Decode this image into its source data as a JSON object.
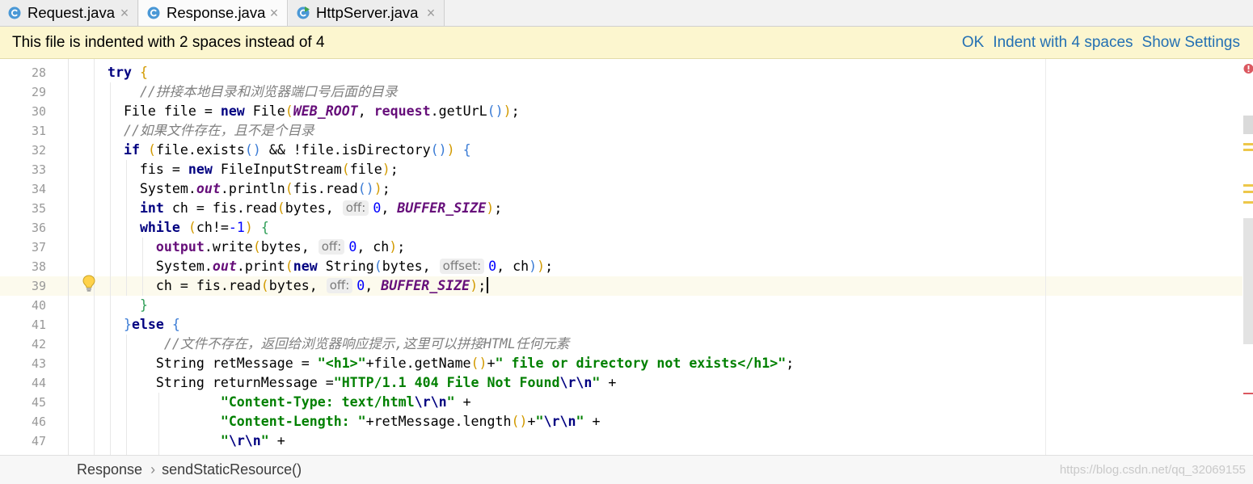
{
  "tabs": [
    {
      "label": "Request.java",
      "active": false,
      "icon": "java-class-icon"
    },
    {
      "label": "Response.java",
      "active": true,
      "icon": "java-class-icon"
    },
    {
      "label": "HttpServer.java",
      "active": false,
      "icon": "java-runnable-class-icon"
    }
  ],
  "tab_close_glyph": "×",
  "notification": {
    "message": "This file is indented with 2 spaces instead of 4",
    "actions": [
      "OK",
      "Indent with 4 spaces",
      "Show Settings"
    ]
  },
  "editor": {
    "caret_line": 39,
    "lines": [
      {
        "num": "28",
        "tokens": [
          [
            "    ",
            "txt"
          ],
          [
            "try",
            "kw"
          ],
          [
            " ",
            "txt"
          ],
          [
            "{",
            "b1"
          ]
        ]
      },
      {
        "num": "29",
        "tokens": [
          [
            "        ",
            "txt"
          ],
          [
            "//拼接本地目录和浏览器端口号后面的目录",
            "cm"
          ]
        ]
      },
      {
        "num": "30",
        "tokens": [
          [
            "      File file = ",
            "txt"
          ],
          [
            "new",
            "kw"
          ],
          [
            " File",
            "txt"
          ],
          [
            "(",
            "b1"
          ],
          [
            "WEB_ROOT",
            "st"
          ],
          [
            ", ",
            "txt"
          ],
          [
            "request",
            "fld"
          ],
          [
            ".getUrL",
            "txt"
          ],
          [
            "(",
            "b2"
          ],
          [
            ")",
            "b2"
          ],
          [
            ")",
            "b1"
          ],
          [
            ";",
            "txt"
          ]
        ]
      },
      {
        "num": "31",
        "tokens": [
          [
            "      ",
            "txt"
          ],
          [
            "//如果文件存在，且不是个目录",
            "cm"
          ]
        ]
      },
      {
        "num": "32",
        "tokens": [
          [
            "      ",
            "txt"
          ],
          [
            "if",
            "kw"
          ],
          [
            " ",
            "txt"
          ],
          [
            "(",
            "b1"
          ],
          [
            "file.exists",
            "txt"
          ],
          [
            "(",
            "b2"
          ],
          [
            ")",
            "b2"
          ],
          [
            " && !file.isDirectory",
            "txt"
          ],
          [
            "(",
            "b2"
          ],
          [
            ")",
            "b2"
          ],
          [
            ")",
            "b1"
          ],
          [
            " ",
            "txt"
          ],
          [
            "{",
            "b2"
          ]
        ]
      },
      {
        "num": "33",
        "tokens": [
          [
            "        fis = ",
            "txt"
          ],
          [
            "new",
            "kw"
          ],
          [
            " FileInputStream",
            "txt"
          ],
          [
            "(",
            "b1"
          ],
          [
            "file",
            "txt"
          ],
          [
            ")",
            "b1"
          ],
          [
            ";",
            "txt"
          ]
        ]
      },
      {
        "num": "34",
        "tokens": [
          [
            "        System.",
            "txt"
          ],
          [
            "out",
            "st"
          ],
          [
            ".println",
            "txt"
          ],
          [
            "(",
            "b1"
          ],
          [
            "fis.read",
            "txt"
          ],
          [
            "(",
            "b2"
          ],
          [
            ")",
            "b2"
          ],
          [
            ")",
            "b1"
          ],
          [
            ";",
            "txt"
          ]
        ]
      },
      {
        "num": "35",
        "tokens": [
          [
            "        ",
            "txt"
          ],
          [
            "int",
            "kw"
          ],
          [
            " ch = fis.read",
            "txt"
          ],
          [
            "(",
            "b1"
          ],
          [
            "bytes, ",
            "txt"
          ],
          [
            "off:",
            "hint"
          ],
          [
            "0",
            "num"
          ],
          [
            ", ",
            "txt"
          ],
          [
            "BUFFER_SIZE",
            "st"
          ],
          [
            ")",
            "b1"
          ],
          [
            ";",
            "txt"
          ]
        ]
      },
      {
        "num": "36",
        "tokens": [
          [
            "        ",
            "txt"
          ],
          [
            "while",
            "kw"
          ],
          [
            " ",
            "txt"
          ],
          [
            "(",
            "b1"
          ],
          [
            "ch!=",
            "txt"
          ],
          [
            "-1",
            "num"
          ],
          [
            ")",
            "b1"
          ],
          [
            " ",
            "txt"
          ],
          [
            "{",
            "b3"
          ]
        ]
      },
      {
        "num": "37",
        "tokens": [
          [
            "          ",
            "txt"
          ],
          [
            "output",
            "fld"
          ],
          [
            ".write",
            "txt"
          ],
          [
            "(",
            "b1"
          ],
          [
            "bytes, ",
            "txt"
          ],
          [
            "off:",
            "hint"
          ],
          [
            "0",
            "num"
          ],
          [
            ", ch",
            "txt"
          ],
          [
            ")",
            "b1"
          ],
          [
            ";",
            "txt"
          ]
        ]
      },
      {
        "num": "38",
        "tokens": [
          [
            "          System.",
            "txt"
          ],
          [
            "out",
            "st"
          ],
          [
            ".print",
            "txt"
          ],
          [
            "(",
            "b1"
          ],
          [
            "new",
            "kw"
          ],
          [
            " String",
            "txt"
          ],
          [
            "(",
            "b2"
          ],
          [
            "bytes, ",
            "txt"
          ],
          [
            "offset:",
            "hint"
          ],
          [
            "0",
            "num"
          ],
          [
            ", ch",
            "txt"
          ],
          [
            ")",
            "b2"
          ],
          [
            ")",
            "b1"
          ],
          [
            ";",
            "txt"
          ]
        ]
      },
      {
        "num": "39",
        "tokens": [
          [
            "          ch = fis.read",
            "txt"
          ],
          [
            "(",
            "b1"
          ],
          [
            "bytes, ",
            "txt"
          ],
          [
            "off:",
            "hint"
          ],
          [
            "0",
            "num"
          ],
          [
            ", ",
            "txt"
          ],
          [
            "BUFFER_SIZE",
            "st"
          ],
          [
            ")",
            "b1"
          ],
          [
            ";",
            "txt"
          ]
        ]
      },
      {
        "num": "40",
        "tokens": [
          [
            "        ",
            "txt"
          ],
          [
            "}",
            "b3"
          ]
        ]
      },
      {
        "num": "41",
        "tokens": [
          [
            "      ",
            "txt"
          ],
          [
            "}",
            "b2"
          ],
          [
            "else",
            "kw"
          ],
          [
            " ",
            "txt"
          ],
          [
            "{",
            "b2"
          ]
        ]
      },
      {
        "num": "42",
        "tokens": [
          [
            "           ",
            "txt"
          ],
          [
            "//文件不存在，返回给浏览器响应提示,这里可以拼接HTML任何元素",
            "cm"
          ]
        ]
      },
      {
        "num": "43",
        "tokens": [
          [
            "          String retMessage = ",
            "txt"
          ],
          [
            "\"<h1>\"",
            "str"
          ],
          [
            "+file.getName",
            "txt"
          ],
          [
            "(",
            "b1"
          ],
          [
            ")",
            "b1"
          ],
          [
            "+",
            "txt"
          ],
          [
            "\" file or directory not exists</h1>\"",
            "str"
          ],
          [
            ";",
            "txt"
          ]
        ]
      },
      {
        "num": "44",
        "tokens": [
          [
            "          String returnMessage =",
            "txt"
          ],
          [
            "\"HTTP/1.1 404 File Not Found",
            "str"
          ],
          [
            "\\r\\n",
            "esc"
          ],
          [
            "\"",
            "str"
          ],
          [
            " +",
            "txt"
          ]
        ]
      },
      {
        "num": "45",
        "tokens": [
          [
            "                  ",
            "txt"
          ],
          [
            "\"Content-Type: text/html",
            "str"
          ],
          [
            "\\r\\n",
            "esc"
          ],
          [
            "\"",
            "str"
          ],
          [
            " +",
            "txt"
          ]
        ]
      },
      {
        "num": "46",
        "tokens": [
          [
            "                  ",
            "txt"
          ],
          [
            "\"Content-Length: \"",
            "str"
          ],
          [
            "+retMessage.length",
            "txt"
          ],
          [
            "(",
            "b1"
          ],
          [
            ")",
            "b1"
          ],
          [
            "+",
            "txt"
          ],
          [
            "\"",
            "str"
          ],
          [
            "\\r\\n",
            "esc"
          ],
          [
            "\"",
            "str"
          ],
          [
            " +",
            "txt"
          ]
        ]
      },
      {
        "num": "47",
        "tokens": [
          [
            "                  ",
            "txt"
          ],
          [
            "\"",
            "str"
          ],
          [
            "\\r\\n",
            "esc"
          ],
          [
            "\"",
            "str"
          ],
          [
            " +",
            "txt"
          ]
        ]
      }
    ]
  },
  "breadcrumbs": [
    "Response",
    "sendStaticResource()"
  ],
  "breadcrumb_separator": "›",
  "watermark": "https://blog.csdn.net/qq_32069155",
  "colors": {
    "keyword": "#000080",
    "string": "#008000",
    "escape": "#000080",
    "number": "#0000FF",
    "comment": "#808080",
    "field": "#660E7A",
    "bracket1": "#D29A00",
    "bracket2": "#3A7BD5",
    "bracket3": "#2E9E57",
    "link": "#2470B3",
    "current_line": "#FCFAED",
    "notification_bg": "#FCF6CF",
    "line_number": "#999999",
    "error": "#DB5860",
    "warning_mark": "#EDC74A"
  }
}
